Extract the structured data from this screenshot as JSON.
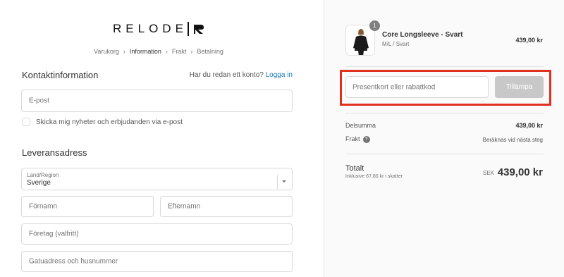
{
  "brand": {
    "logo_text": "RELODE"
  },
  "breadcrumb": [
    {
      "label": "Varukorg"
    },
    {
      "label": "Information",
      "active": true
    },
    {
      "label": "Frakt"
    },
    {
      "label": "Betalning"
    }
  ],
  "contact": {
    "title": "Kontaktinformation",
    "login_prompt": "Har du redan ett konto?",
    "login_link": "Logga in",
    "email_placeholder": "E-post",
    "newsletter_label": "Skicka mig nyheter och erbjudanden via e-post"
  },
  "shipping": {
    "title": "Leveransadress",
    "country_label": "Land/Region",
    "country_value": "Sverige",
    "first_name_placeholder": "Förnamn",
    "last_name_placeholder": "Efternamn",
    "company_placeholder": "Företag (valfritt)",
    "address_placeholder": "Gatuadress och husnummer"
  },
  "order": {
    "product": {
      "name": "Core Longsleeve - Svart",
      "variant": "M/L / Svart",
      "price": "439,00 kr",
      "quantity": "1"
    },
    "discount": {
      "placeholder": "Presentkort eller rabattkod",
      "apply_label": "Tillämpa"
    },
    "subtotal_label": "Delsumma",
    "subtotal_value": "439,00 kr",
    "shipping_label": "Frakt",
    "shipping_value": "Beräknas vid nästa steg",
    "total_label": "Totalt",
    "tax_note": "Inklusive 67,80 kr i skatter",
    "currency": "SEK",
    "total_value": "439,00 kr"
  },
  "colors": {
    "highlight": "#e0301e",
    "link": "#197bbd",
    "button_disabled": "#c8c8c8"
  }
}
